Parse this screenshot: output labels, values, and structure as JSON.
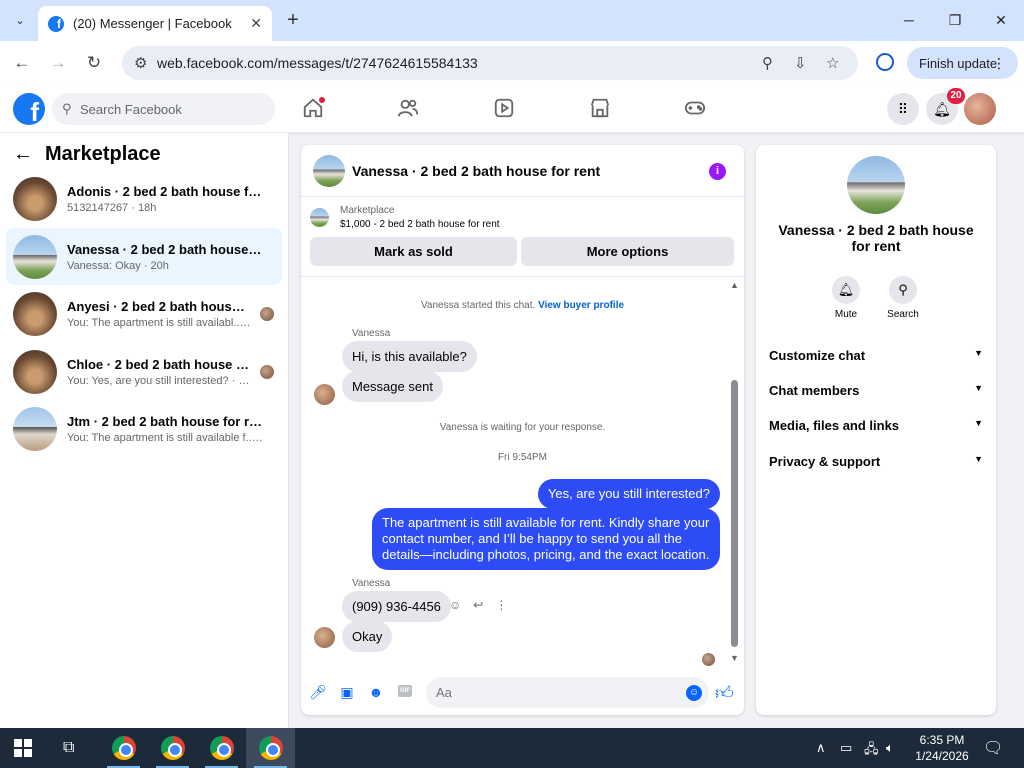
{
  "browser": {
    "tab_title": "(20) Messenger | Facebook",
    "tab_close": "✕",
    "new_tab": "+",
    "url": "web.facebook.com/messages/t/2747624615584133",
    "finish_update": "Finish update"
  },
  "fb_header": {
    "search_placeholder": "Search Facebook",
    "notification_count": "20"
  },
  "left_panel": {
    "title": "Marketplace",
    "conversations": [
      {
        "title": "Adonis · 2 bed 2 bath house for rent",
        "subtitle": "5132147267 · 18h"
      },
      {
        "title": "Vanessa · 2 bed 2 bath house for rent",
        "subtitle": "Vanessa: Okay · 20h"
      },
      {
        "title": "Anyesi · 2 bed 2 bath house for rent",
        "subtitle": "You: The apartment is still availabl... · 20h"
      },
      {
        "title": "Chloe · 2 bed 2 bath house for rent",
        "subtitle": "You: Yes, are you still interested? · 20h"
      },
      {
        "title": "Jtm · 2 bed 2 bath house for rent",
        "subtitle": "You: The apartment is still available f... 20h"
      }
    ]
  },
  "chat": {
    "header_name": "Vanessa · 2 bed 2 bath house for rent",
    "info_icon": "i",
    "marketplace_label": "Marketplace",
    "listing": "$1,000 - 2 bed 2 bath house for rent",
    "mark_sold": "Mark as sold",
    "more_options": "More options",
    "started_text": "Vanessa started this chat.",
    "view_profile": "View buyer profile",
    "sender_name_1": "Vanessa",
    "msg_1": "Hi, is this available?",
    "msg_2": "Message sent",
    "waiting": "Vanessa is waiting for your response.",
    "timestamp": "Fri 9:54PM",
    "out_1": "Yes, are you still interested?",
    "out_2": "The apartment is still available for rent. Kindly share your contact number, and I’ll be happy to send you all the details—including photos, pricing, and the exact location.",
    "sender_name_2": "Vanessa",
    "msg_3": "(909) 936-4456",
    "msg_4": "Okay",
    "composer_placeholder": "Aa",
    "gif": "GIF"
  },
  "right_panel": {
    "name": "Vanessa · 2 bed 2 bath house for rent",
    "mute": "Mute",
    "search": "Search",
    "rows": [
      "Customize chat",
      "Chat members",
      "Media, files and links",
      "Privacy & support"
    ]
  },
  "taskbar": {
    "time": "6:35 PM",
    "date": "1/24/2026"
  }
}
